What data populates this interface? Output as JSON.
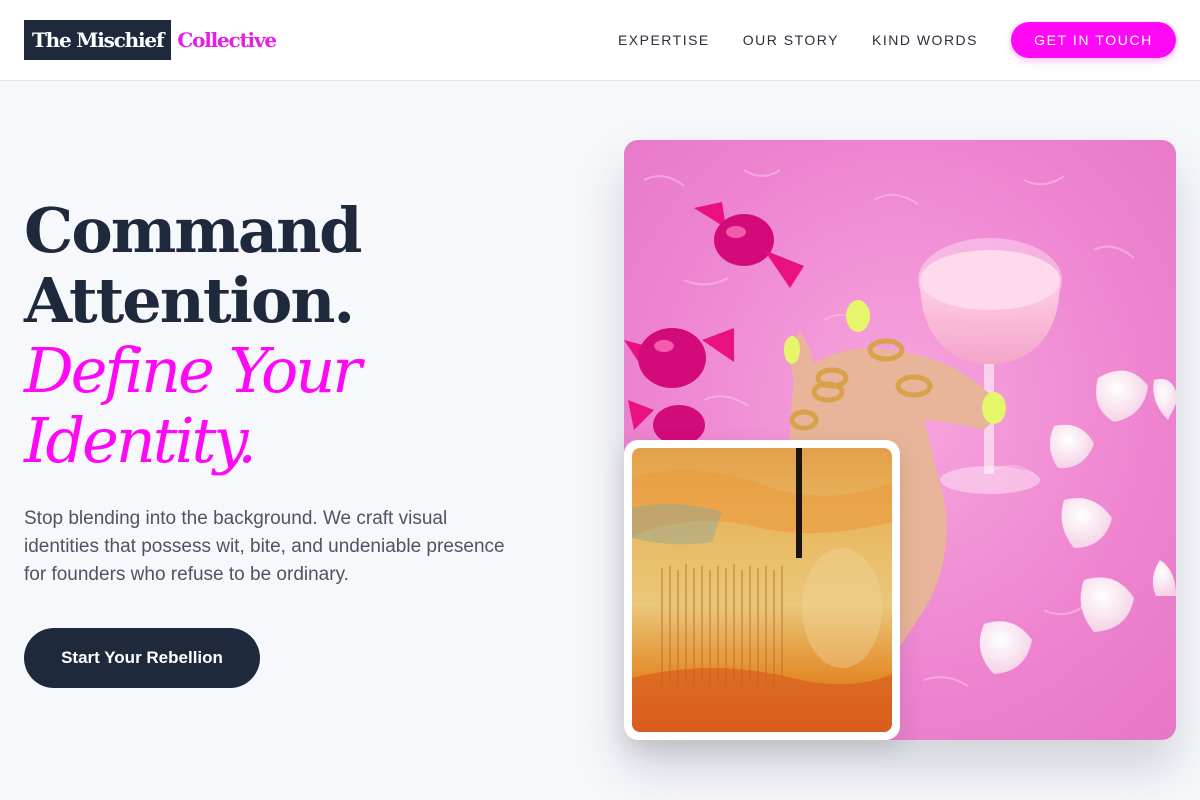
{
  "brand": {
    "name_box": "The Mischief",
    "name_accent": "Collective"
  },
  "nav": {
    "items": [
      "EXPERTISE",
      "OUR STORY",
      "KIND WORDS"
    ],
    "cta_label": "GET IN TOUCH"
  },
  "hero": {
    "headline_line1": "Command",
    "headline_line2": "Attention.",
    "headline_accent1": "Define Your",
    "headline_accent2": "Identity.",
    "subcopy": "Stop blending into the background. We craft visual identities that possess wit, bite, and undeniable presence for founders who refuse to be ordinary.",
    "primary_button": "Start Your Rebellion"
  },
  "images": {
    "main_alt": "Hand with gold rings holding pink cocktail on pink fur with wrapped candies and rose petals",
    "inset_alt": "Orange and yellow textured abstract painting"
  },
  "colors": {
    "accent": "#ff08f6",
    "dark": "#1e293b",
    "background": "#f7f8fc"
  }
}
